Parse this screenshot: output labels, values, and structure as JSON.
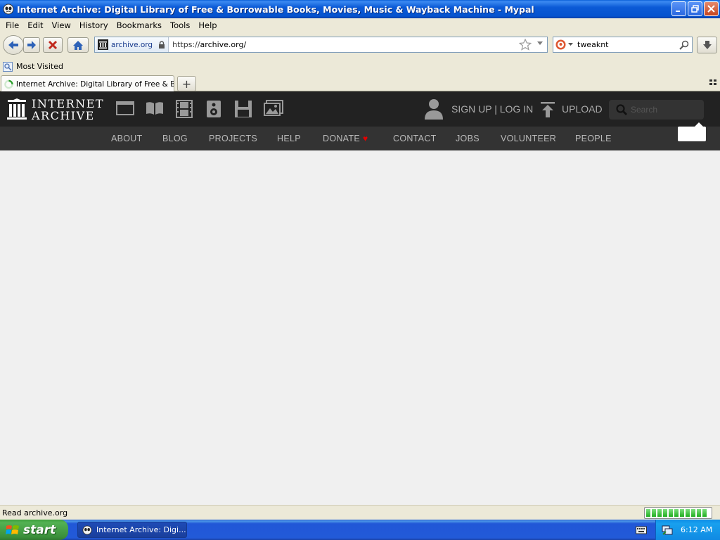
{
  "window": {
    "title": "Internet Archive: Digital Library of Free & Borrowable Books, Movies, Music & Wayback Machine - Mypal"
  },
  "menubar": {
    "items": [
      "File",
      "Edit",
      "View",
      "History",
      "Bookmarks",
      "Tools",
      "Help"
    ]
  },
  "navbar": {
    "site_identity": "archive.org",
    "url_scheme": "https://",
    "url_host": "archive.org/",
    "search_value": "tweaknt"
  },
  "bookmarks": {
    "most_visited": "Most Visited"
  },
  "tabs": {
    "active_title": "Internet Archive: Digital Library of Free & Bo...",
    "new_tab": "+"
  },
  "ia": {
    "logo_line1": "INTERNET",
    "logo_line2": "ARCHIVE",
    "signup": "SIGN UP | LOG IN",
    "upload": "UPLOAD",
    "search_placeholder": "Search",
    "nav": [
      "ABOUT",
      "BLOG",
      "PROJECTS",
      "HELP",
      "DONATE",
      "CONTACT",
      "JOBS",
      "VOLUNTEER",
      "PEOPLE"
    ],
    "donate_heart": "♥"
  },
  "status": {
    "text": "Read archive.org",
    "progress_fraction": 0.9
  },
  "taskbar": {
    "start": "start",
    "task_label": "Internet Archive: Digi...",
    "clock": "6:12 AM"
  },
  "colors": {
    "ia_top_bg": "#222222",
    "ia_nav_bg": "#333333",
    "donate_heart": "#e30000",
    "xp_title_blue": "#0553cf",
    "xp_start_green": "#3a8f3a"
  },
  "icons": [
    "mypal-app-icon",
    "back-arrow-icon",
    "forward-arrow-icon",
    "stop-icon",
    "home-icon",
    "archive-site-icon",
    "lock-icon",
    "star-icon",
    "dropdown-icon",
    "search-engine-icon",
    "magnifier-icon",
    "download-icon",
    "bookmark-icon",
    "loading-spinner-icon",
    "tab-list-icon",
    "ia-logo-icon",
    "web-icon",
    "texts-icon",
    "video-icon",
    "audio-icon",
    "software-icon",
    "images-icon",
    "user-icon",
    "upload-icon",
    "windows-flag-icon",
    "keyboard-icon",
    "network-icon"
  ]
}
